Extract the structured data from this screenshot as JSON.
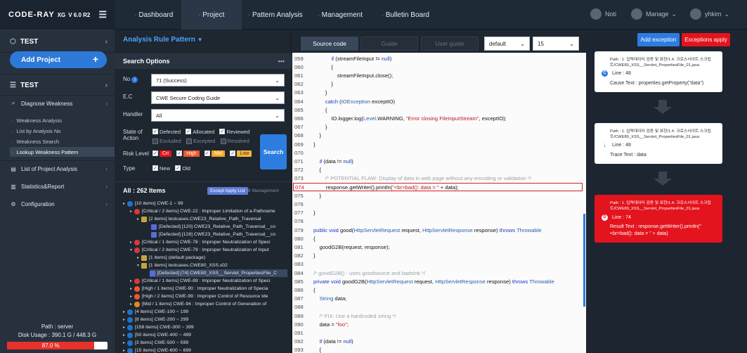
{
  "app": {
    "logo": "CODE-RAY",
    "product": "XG",
    "version": "V 6.0 R2"
  },
  "nav": [
    {
      "label": "Dashboard"
    },
    {
      "label": "Project"
    },
    {
      "label": "Pattern Analysis"
    },
    {
      "label": "Management"
    },
    {
      "label": "Bulletin Board"
    }
  ],
  "topright": {
    "noti": "Noti",
    "manage": "Manage",
    "user": "yhkim"
  },
  "sidebar": {
    "project_header": "TEST",
    "add_project": "Add Project",
    "project_name": "TEST",
    "diagnose": "Diagnose Weakness",
    "subs": [
      "Weakness Analysis",
      "List by Analysis No",
      "Weakness Search",
      "Lookup Weakness Pattern"
    ],
    "menu": [
      "List of Project Analysis",
      "Statistics&Report",
      "Configuration"
    ],
    "path": "Path : server",
    "disk": "Disk Usage : 390.1 G / 448.3 G",
    "disk_percent": "87.0 %",
    "disk_fraction": 0.87
  },
  "options": {
    "title": "Analysis Rule Pattern",
    "section": "Search Options",
    "no_label": "No",
    "no_value": "71 (Success)",
    "ec_label": "E.C",
    "ec_value": "CWE Secure Coding Guide",
    "handler_label": "Handler",
    "handler_value": "All",
    "state_label1": "State of",
    "state_label2": "Action",
    "states": [
      "Defected",
      "Allocated",
      "Reviewed",
      "Excluded",
      "Excepted",
      "Resolved"
    ],
    "risk_label": "Risk Level",
    "risks": [
      "Cri",
      "High",
      "Mid",
      "Low"
    ],
    "type_label": "Type",
    "types": [
      "New",
      "Old"
    ],
    "search": "Search",
    "all_items": "All : 262 Items",
    "except_apply_list": "Except Apply List",
    "management": "Management"
  },
  "tree": [
    "[10 items] CWE-1 ~ 99",
    "[Critical / 2 items] CWE-22 : Improper Limitation of a Pathname",
    "[2 items] testcases.CWE23_Relative_Path_Traversal",
    "[Defected] [120] CWE23_Relative_Path_Traversal__co",
    "[Defected] [128] CWE23_Relative_Path_Traversal__co",
    "[Critical / 1 items] CWE-78 : Improper Neutralization of Speci",
    "[Critical / 2 items] CWE-79 : Improper Neutralization of Input",
    "[1 items] (default package)",
    "[1 items] testcases.CWE80_XSS.s02",
    "[Defected] [74] CWE80_XSS__Servlet_PropertiesFile_C",
    "[Critical / 1 items] CWE-89 : Improper Neutralization of Speci",
    "[High / 1 items] CWE-90 : Improper Neutralization of Specia",
    "[High / 2 items] CWE-99 : Improper Control of Resource Ide",
    "[Mid / 1 items] CWE-94 : Improper Control of Generation of",
    "[4 items] CWE-100 ~ 199",
    "[8 items] CWE-200 ~ 299",
    "[158 items] CWE-300 ~ 399",
    "[50 items] CWE-400 ~ 499",
    "[3 items] CWE-500 ~ 599",
    "[15 items] CWE-600 ~ 699"
  ],
  "code_panel": {
    "tabs": [
      "Source code",
      "Guide",
      "User guide"
    ],
    "theme": "default",
    "fontsize": "15",
    "lines": [
      {
        "no": "059",
        "html": "            <span class='k'>if</span> (streamFileInput != <span class='k'>null</span>)"
      },
      {
        "no": "060",
        "html": "            {"
      },
      {
        "no": "061",
        "html": "                streamFileInput.close();"
      },
      {
        "no": "062",
        "html": "            }"
      },
      {
        "no": "063",
        "html": "        }"
      },
      {
        "no": "064",
        "html": "        <span class='k'>catch</span> (<span class='t'>IOException</span> exceptIO)"
      },
      {
        "no": "065",
        "html": "        {"
      },
      {
        "no": "066",
        "html": "            IO.logger.log(<span class='t'>Level</span>.WARNING, <span class='s'>\"Error closing FileInputStream\"</span>, exceptIO);"
      },
      {
        "no": "067",
        "html": "        }"
      },
      {
        "no": "068",
        "html": "    }"
      },
      {
        "no": "069",
        "html": "}"
      },
      {
        "no": "070",
        "html": ""
      },
      {
        "no": "071",
        "html": "    <span class='k'>if</span> (data != <span class='k'>null</span>)"
      },
      {
        "no": "072",
        "html": "    {"
      },
      {
        "no": "073",
        "html": "        <span class='cm'>/* POTENTIAL FLAW: Display of data in web page without any encoding or validation */</span>"
      },
      {
        "no": "074",
        "html": "        response.getWriter().println(<span class='s'>\"&lt;br&gt;bad(): data = \"</span> + data);"
      },
      {
        "no": "075",
        "html": "    }"
      },
      {
        "no": "076",
        "html": ""
      },
      {
        "no": "077",
        "html": "}"
      },
      {
        "no": "078",
        "html": ""
      },
      {
        "no": "079",
        "html": "<span class='k'>public void</span> good(<span class='t'>HttpServletRequest</span> request, <span class='t'>HttpServletResponse</span> response) <span class='k'>throws</span> <span class='t'>Throwable</span>"
      },
      {
        "no": "080",
        "html": "{"
      },
      {
        "no": "081",
        "html": "    goodG2B(request, response);"
      },
      {
        "no": "082",
        "html": "}"
      },
      {
        "no": "083",
        "html": ""
      },
      {
        "no": "084",
        "html": "<span class='cm'>/* goodG2B() - uses goodsource and badsink */</span>"
      },
      {
        "no": "085",
        "html": "<span class='k'>private void</span> goodG2B(<span class='t'>HttpServletRequest</span> request, <span class='t'>HttpServletResponse</span> response) <span class='k'>throws</span> <span class='t'>Throwable</span>"
      },
      {
        "no": "086",
        "html": "{"
      },
      {
        "no": "087",
        "html": "    <span class='t'>String</span> data;"
      },
      {
        "no": "088",
        "html": ""
      },
      {
        "no": "089",
        "html": "    <span class='cm'>/* FIX: Use a hardcoded string */</span>"
      },
      {
        "no": "090",
        "html": "    data = <span class='s'>\"foo\"</span>;"
      },
      {
        "no": "091",
        "html": ""
      },
      {
        "no": "092",
        "html": "    <span class='k'>if</span> (data != <span class='k'>null</span>)"
      },
      {
        "no": "093",
        "html": "    {"
      }
    ]
  },
  "right": {
    "add_exception": "Add exception",
    "exceptions_apply": "Exceptions apply",
    "cards": [
      {
        "path": "Path : 1. 입력데이터 검증 및 표현/1.4. 크로스사이트 스크립트/CWE80_XSS__Servlet_PropertiesFile_01.java",
        "badge": "C",
        "line": "Line : 48",
        "text": "Cause Text : properties.getProperty(\"data\")"
      },
      {
        "path": "Path : 1. 입력데이터 검증 및 표현/1.4. 크로스사이트 스크립트/CWE80_XSS__Servlet_PropertiesFile_01.java",
        "badge": "↓",
        "line": "Line : 48",
        "text": "Trace Text : data"
      },
      {
        "path": "Path : 1. 입력데이터 검증 및 표현/1.4. 크로스사이트 스크립트/CWE80_XSS__Servlet_PropertiesFile_01.java",
        "badge": "D",
        "line": "Line : 74",
        "text": "Result Text : response.getWriter().println(\"",
        "text2": "<br>bad(): data = \" + data)"
      }
    ]
  },
  "colors": {
    "accent": "#2d7de0",
    "danger": "#e3141d",
    "cri": "#e3141d",
    "high": "#f0562a",
    "mid": "#f5a623",
    "low": "#f5b63a"
  }
}
